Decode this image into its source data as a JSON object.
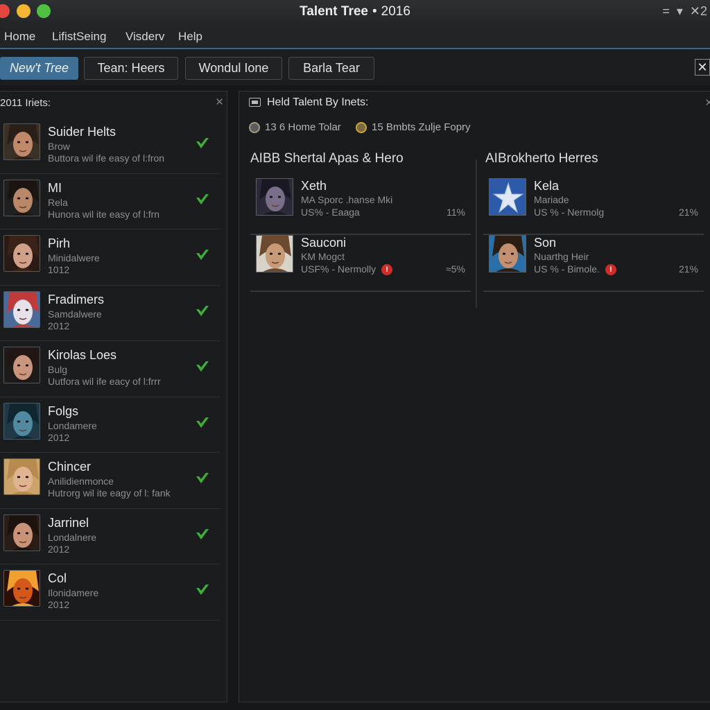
{
  "window": {
    "title_bold": "Talent Tree",
    "title_sep": "•",
    "title_year": "2016",
    "controls": [
      "=",
      "▾",
      "✕2"
    ]
  },
  "menu": [
    "Home",
    "LifistSeing",
    "Visderv",
    "Help"
  ],
  "tabs": [
    {
      "label": "New't Tree",
      "active": true
    },
    {
      "label": "Tean: Heers",
      "active": false
    },
    {
      "label": "Wondul Ione",
      "active": false
    },
    {
      "label": "Barla Tear",
      "active": false
    }
  ],
  "tab_close": "✕",
  "left_panel": {
    "title": "2011 Iriets:",
    "close": "✕",
    "items": [
      {
        "name": "Suider Helts",
        "line1": "Brow",
        "line2": "Buttora wil ife easy of l:fron",
        "avatar": "man-face-1"
      },
      {
        "name": "MI",
        "line1": "Rela",
        "line2": "Hunora wil ite easy of l:frn",
        "avatar": "man-face-2"
      },
      {
        "name": "Pirh",
        "line1": "Minidalwere",
        "line2": "1012",
        "avatar": "woman-face-1"
      },
      {
        "name": "Fradimers",
        "line1": "Samdalwere",
        "line2": "2012",
        "avatar": "painted-face"
      },
      {
        "name": "Kirolas Loes",
        "line1": "Bulg",
        "line2": "Uutfora wil ife eacy of l:frrr",
        "avatar": "woman-face-2"
      },
      {
        "name": "Folgs",
        "line1": "Londamere",
        "line2": "2012",
        "avatar": "alien-face"
      },
      {
        "name": "Chincer",
        "line1": "Anilidienmonce",
        "line2": "Hutrorg wil ite eagy of l: fank",
        "avatar": "woman-face-3"
      },
      {
        "name": "Jarrinel",
        "line1": "Londalnere",
        "line2": "2012",
        "avatar": "woman-face-4"
      },
      {
        "name": "Col",
        "line1": "Ilonidamere",
        "line2": "2012",
        "avatar": "fire-face"
      }
    ]
  },
  "right_panel": {
    "title": "Held Talent By Inets:",
    "close": "✕",
    "stats": [
      "13 6 Home Tolar",
      "15 Bmbts Zulje Fopry"
    ],
    "columns": [
      {
        "heading": "AIBB Shertal Apas & Hero",
        "cards": [
          {
            "name": "Xeth",
            "sub": "MA  Sporc .hanse Mki",
            "meta": "US%  -  Eaaga",
            "pct": "11%",
            "warn": false,
            "avatar": "dark-elf-face"
          },
          {
            "name": "Sauconi",
            "sub": "KM Mogct",
            "meta": "USF%  -  Nermolly",
            "pct": "≈5%",
            "warn": true,
            "avatar": "boy-face"
          }
        ]
      },
      {
        "heading": "AIBrokherto Herres",
        "cards": [
          {
            "name": "Kela",
            "sub": "Mariade",
            "meta": "US %  -  Nermolg",
            "pct": "21%",
            "warn": false,
            "avatar": "star-emblem"
          },
          {
            "name": "Son",
            "sub": "Nuarthg Heir",
            "meta": "US %  -  Bimole.",
            "pct": "21%",
            "warn": true,
            "avatar": "young-man-face"
          }
        ]
      }
    ]
  },
  "warn_glyph": "!",
  "colors": {
    "accent": "#3f6f95",
    "check_green": "#3fae3a",
    "warn_red": "#cf2d2a",
    "menu_underline": "#3a6a8a"
  }
}
